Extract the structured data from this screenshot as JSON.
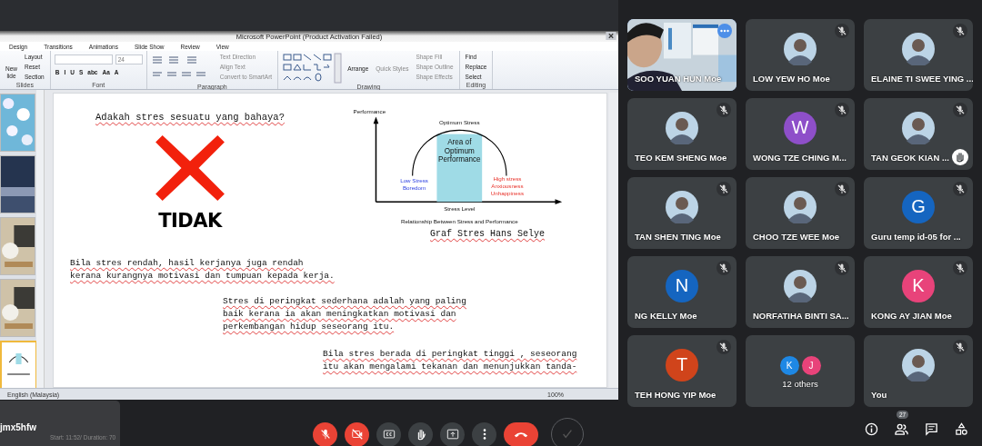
{
  "powerpoint": {
    "title": "Microsoft PowerPoint (Product Activation Failed)",
    "tabs": [
      "Design",
      "Transitions",
      "Animations",
      "Slide Show",
      "Review",
      "View"
    ],
    "ribbon_groups": [
      {
        "name": "Slides",
        "kind": "slides",
        "big": [
          "New",
          "lide"
        ],
        "items": [
          "Layout",
          "Reset",
          "Section"
        ]
      },
      {
        "name": "Font",
        "kind": "font",
        "size": "24",
        "format": [
          "B",
          "I",
          "U",
          "S",
          "abc",
          "Aa",
          "A"
        ]
      },
      {
        "name": "Paragraph",
        "kind": "paragraph",
        "items": [
          "Text Direction",
          "Align Text",
          "Convert to SmartArt"
        ]
      },
      {
        "name": "Drawing",
        "kind": "drawing",
        "big": [
          "Arrange",
          "Quick Styles"
        ],
        "items": [
          "Shape Fill",
          "Shape Outline",
          "Shape Effects"
        ]
      },
      {
        "name": "Editing",
        "kind": "buttons",
        "items": [
          "Find",
          "Replace",
          "Select"
        ]
      }
    ],
    "thumbnails": [
      {
        "selected": false
      },
      {
        "selected": false
      },
      {
        "selected": false
      },
      {
        "selected": false
      },
      {
        "selected": true
      }
    ],
    "slide": {
      "question": "Adakah stres sesuatu yang bahaya?",
      "answer": "TIDAK",
      "diagram": {
        "y_label": "Performance",
        "peak": "Optimum Stress",
        "area": [
          "Area of",
          "Optimum",
          "Performance"
        ],
        "low": [
          "Low Stress",
          "Boredom"
        ],
        "high": [
          "High stress",
          "Anxiousness",
          "Unhappiness"
        ],
        "x_label": "Stress Level",
        "title": "Relationship Between Stress and Performance"
      },
      "caption": "Graf Stres Hans Selye",
      "paragraphs": [
        [
          "Bila stres rendah, hasil kerjanya juga rendah",
          "kerana kurangnya motivasi dan tumpuan kepada kerja."
        ],
        [
          "Stres di peringkat sederhana adalah yang paling",
          "baik kerana ia akan meningkatkan motivasi dan",
          "perkembangan hidup seseorang itu."
        ],
        [
          "Bila stres berada di peringkat tinggi , seseorang",
          "itu akan mengalami tekanan dan menunjukkan tanda-"
        ]
      ]
    },
    "status_bar": {
      "language": "English (Malaysia)",
      "zoom": "100%"
    }
  },
  "participants": [
    {
      "name": "SOO YUAN HUN Moe",
      "kind": "video",
      "muted": false,
      "highlighted": true,
      "hand_raised": false
    },
    {
      "name": "LOW YEW HO Moe",
      "muted": true,
      "highlighted": false,
      "hand_raised": false
    },
    {
      "name": "ELAINE TI SWEE YING ...",
      "muted": true,
      "highlighted": false,
      "hand_raised": false
    },
    {
      "name": "TEO KEM SHENG Moe",
      "muted": true,
      "highlighted": false,
      "hand_raised": false
    },
    {
      "name": "WONG TZE CHING M...",
      "kind": "letter",
      "letter": "W",
      "color": "#8e4fc9",
      "muted": true,
      "highlighted": false,
      "hand_raised": false
    },
    {
      "name": "TAN GEOK KIAN ...",
      "muted": true,
      "highlighted": false,
      "hand_raised": true
    },
    {
      "name": "TAN SHEN TING Moe",
      "muted": true,
      "highlighted": false,
      "hand_raised": false
    },
    {
      "name": "CHOO TZE WEE Moe",
      "muted": true,
      "highlighted": false,
      "hand_raised": false
    },
    {
      "name": "Guru temp id-05 for ...",
      "kind": "letter",
      "letter": "G",
      "color": "#1565c0",
      "muted": true,
      "highlighted": false,
      "hand_raised": false
    },
    {
      "name": "NG KELLY Moe",
      "kind": "letter",
      "letter": "N",
      "color": "#1565c0",
      "muted": true,
      "highlighted": false,
      "hand_raised": false
    },
    {
      "name": "NORFATIHA BINTI SA...",
      "muted": true,
      "highlighted": false,
      "hand_raised": false
    },
    {
      "name": "KONG AY JIAN Moe",
      "kind": "letter",
      "letter": "K",
      "color": "#e8437a",
      "muted": true,
      "highlighted": false,
      "hand_raised": false
    },
    {
      "name": "TEH HONG YIP Moe",
      "kind": "letter",
      "letter": "T",
      "color": "#d0441b",
      "muted": true,
      "highlighted": false,
      "hand_raised": false
    },
    {
      "name": "12 others",
      "kind": "others",
      "others": [
        {
          "letter": "K",
          "color": "#1e88e5"
        },
        {
          "letter": "J",
          "color": "#e8437a"
        }
      ],
      "muted": false,
      "highlighted": false,
      "hand_raised": false
    },
    {
      "name": "You",
      "muted": true,
      "highlighted": false,
      "hand_raised": false
    }
  ],
  "meeting": {
    "code": "jmx5hfw",
    "info": "Start: 11:52/ Duration: 70"
  },
  "controls": [
    {
      "kind": "mic",
      "on": false
    },
    {
      "kind": "camera",
      "on": false
    },
    {
      "kind": "captions"
    },
    {
      "kind": "hand"
    },
    {
      "kind": "present"
    },
    {
      "kind": "more"
    },
    {
      "kind": "hangup"
    },
    {
      "kind": "check"
    }
  ],
  "side_buttons": [
    {
      "kind": "info"
    },
    {
      "kind": "people",
      "badge": "27"
    },
    {
      "kind": "chat"
    },
    {
      "kind": "activities"
    }
  ]
}
